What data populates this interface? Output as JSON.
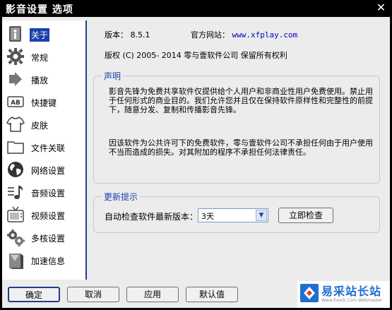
{
  "window": {
    "title": "影音设置 选项",
    "close_glyph": "✕"
  },
  "sidebar": {
    "items": [
      {
        "label": "关于",
        "icon": "about-book-icon",
        "selected": true
      },
      {
        "label": "常规",
        "icon": "gear-icon"
      },
      {
        "label": "播放",
        "icon": "play-arrow-icon"
      },
      {
        "label": "快捷键",
        "icon": "keyboard-ab-icon"
      },
      {
        "label": "皮肤",
        "icon": "shirt-icon"
      },
      {
        "label": "文件关联",
        "icon": "folder-icon"
      },
      {
        "label": "网络设置",
        "icon": "globe-icon"
      },
      {
        "label": "音频设置",
        "icon": "audio-note-icon"
      },
      {
        "label": "视频设置",
        "icon": "tv-icon"
      },
      {
        "label": "多核设置",
        "icon": "multi-gear-icon"
      },
      {
        "label": "加速信息",
        "icon": "acceleration-icon"
      }
    ]
  },
  "about": {
    "version_label": "版本：",
    "version_value": "8.5.1",
    "website_label": "官方网站：",
    "website_url": "www.xfplay.com",
    "copyright": "版权 (C) 2005- 2014 零与壹软件公司 保留所有权利"
  },
  "statement": {
    "title": "声明",
    "paragraph1": "影音先锋为免费共享软件仅提供给个人用户和非商业性用户免费使用。禁止用于任何形式的商业目的。我们允许您并且仅在保持软件原样性和完整性的前提下，随意分发、复制和传播影音先锋。",
    "paragraph2": "因该软件为公共许可下的免费软件，零与壹软件公司不承担任何由于用户使用不当而造成的损失。对其附加的程序不承担任何法律责任。"
  },
  "update": {
    "title": "更新提示",
    "auto_check_label": "自动检查软件最新版本：",
    "interval_value": "3天",
    "check_now_label": "立即检查"
  },
  "buttons": {
    "ok": "确定",
    "cancel": "取消",
    "apply": "应用",
    "default": "默认值"
  },
  "watermark": {
    "name": "易采站长站",
    "sub": "Www.Easck.Com Webmaster"
  },
  "colors": {
    "title_bg": "#000000",
    "accent": "#1a3fae",
    "link": "#0000c0",
    "panel_bg": "#ececec"
  }
}
